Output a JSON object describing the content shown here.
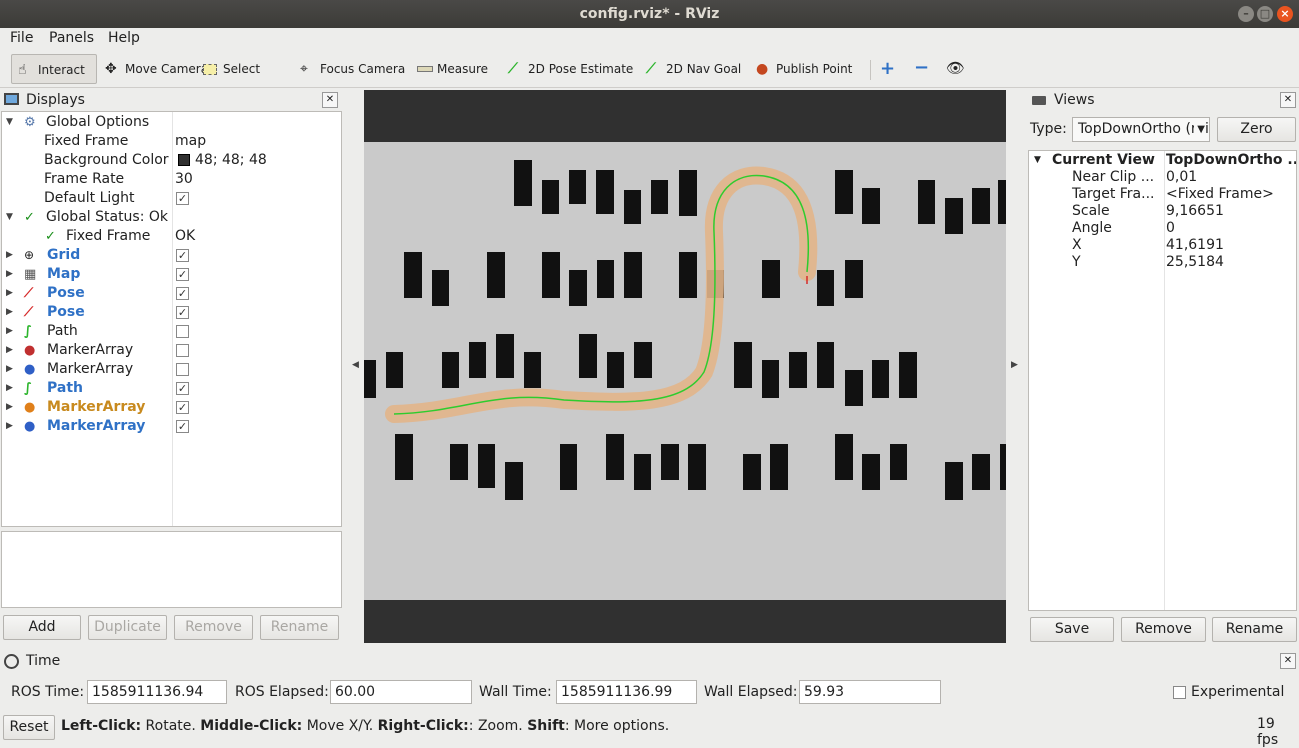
{
  "window": {
    "title": "config.rviz* - RViz"
  },
  "menu": [
    "File",
    "Panels",
    "Help"
  ],
  "toolbar": [
    {
      "label": "Interact",
      "icon": "hand-pointer-icon"
    },
    {
      "label": "Move Camera",
      "icon": "move-camera-icon"
    },
    {
      "label": "Select",
      "icon": "select-box-icon"
    },
    {
      "label": "Focus Camera",
      "icon": "focus-camera-icon"
    },
    {
      "label": "Measure",
      "icon": "ruler-icon"
    },
    {
      "label": "2D Pose Estimate",
      "icon": "green-arrow-icon"
    },
    {
      "label": "2D Nav Goal",
      "icon": "green-arrow-icon"
    },
    {
      "label": "Publish Point",
      "icon": "map-pin-icon"
    }
  ],
  "displays": {
    "title": "Displays",
    "global_options": "Global Options",
    "fixed_frame_label": "Fixed Frame",
    "fixed_frame_value": "map",
    "background_color_label": "Background Color",
    "background_color_value": "48; 48; 48",
    "frame_rate_label": "Frame Rate",
    "frame_rate_value": "30",
    "default_light_label": "Default Light",
    "global_status": "Global Status: Ok",
    "status_fixed_frame": "Fixed Frame",
    "status_fixed_frame_value": "OK",
    "items": [
      {
        "label": "Grid",
        "checked": true
      },
      {
        "label": "Map",
        "checked": true
      },
      {
        "label": "Pose",
        "checked": true
      },
      {
        "label": "Pose",
        "checked": true
      },
      {
        "label": "Path",
        "checked": false
      },
      {
        "label": "MarkerArray",
        "checked": false
      },
      {
        "label": "MarkerArray",
        "checked": false
      },
      {
        "label": "Path",
        "checked": true
      },
      {
        "label": "MarkerArray",
        "checked": true
      },
      {
        "label": "MarkerArray",
        "checked": true
      }
    ],
    "buttons": {
      "add": "Add",
      "duplicate": "Duplicate",
      "remove": "Remove",
      "rename": "Rename"
    }
  },
  "views": {
    "title": "Views",
    "type_label": "Type:",
    "type_value": "TopDownOrtho (rviz)",
    "zero": "Zero",
    "current_view": "Current View",
    "current_view_value": "TopDownOrtho ...",
    "props": [
      {
        "name": "Near Clip ...",
        "value": "0,01"
      },
      {
        "name": "Target Fra...",
        "value": "<Fixed Frame>"
      },
      {
        "name": "Scale",
        "value": "9,16651"
      },
      {
        "name": "Angle",
        "value": "0"
      },
      {
        "name": "X",
        "value": "41,6191"
      },
      {
        "name": "Y",
        "value": "25,5184"
      }
    ],
    "buttons": {
      "save": "Save",
      "remove": "Remove",
      "rename": "Rename"
    }
  },
  "time": {
    "title": "Time",
    "ros_time_label": "ROS Time:",
    "ros_time": "1585911136.94",
    "ros_elapsed_label": "ROS Elapsed:",
    "ros_elapsed": "60.00",
    "wall_time_label": "Wall Time:",
    "wall_time": "1585911136.99",
    "wall_elapsed_label": "Wall Elapsed:",
    "wall_elapsed": "59.93",
    "experimental": "Experimental"
  },
  "statusbar": {
    "reset": "Reset",
    "left_click": "Left-Click:",
    "left_click_desc": " Rotate. ",
    "middle_click": "Middle-Click:",
    "middle_click_desc": " Move X/Y. ",
    "right_click": "Right-Click:",
    "right_click_desc": ": Zoom. ",
    "shift": "Shift",
    "shift_desc": ": More options.",
    "fps": "19 fps"
  },
  "colors": {
    "accent_blue": "#2f71c6",
    "accent_orange": "#c88a1e",
    "path_green": "#2ecc2e",
    "path_glow": "#e2b58a"
  }
}
